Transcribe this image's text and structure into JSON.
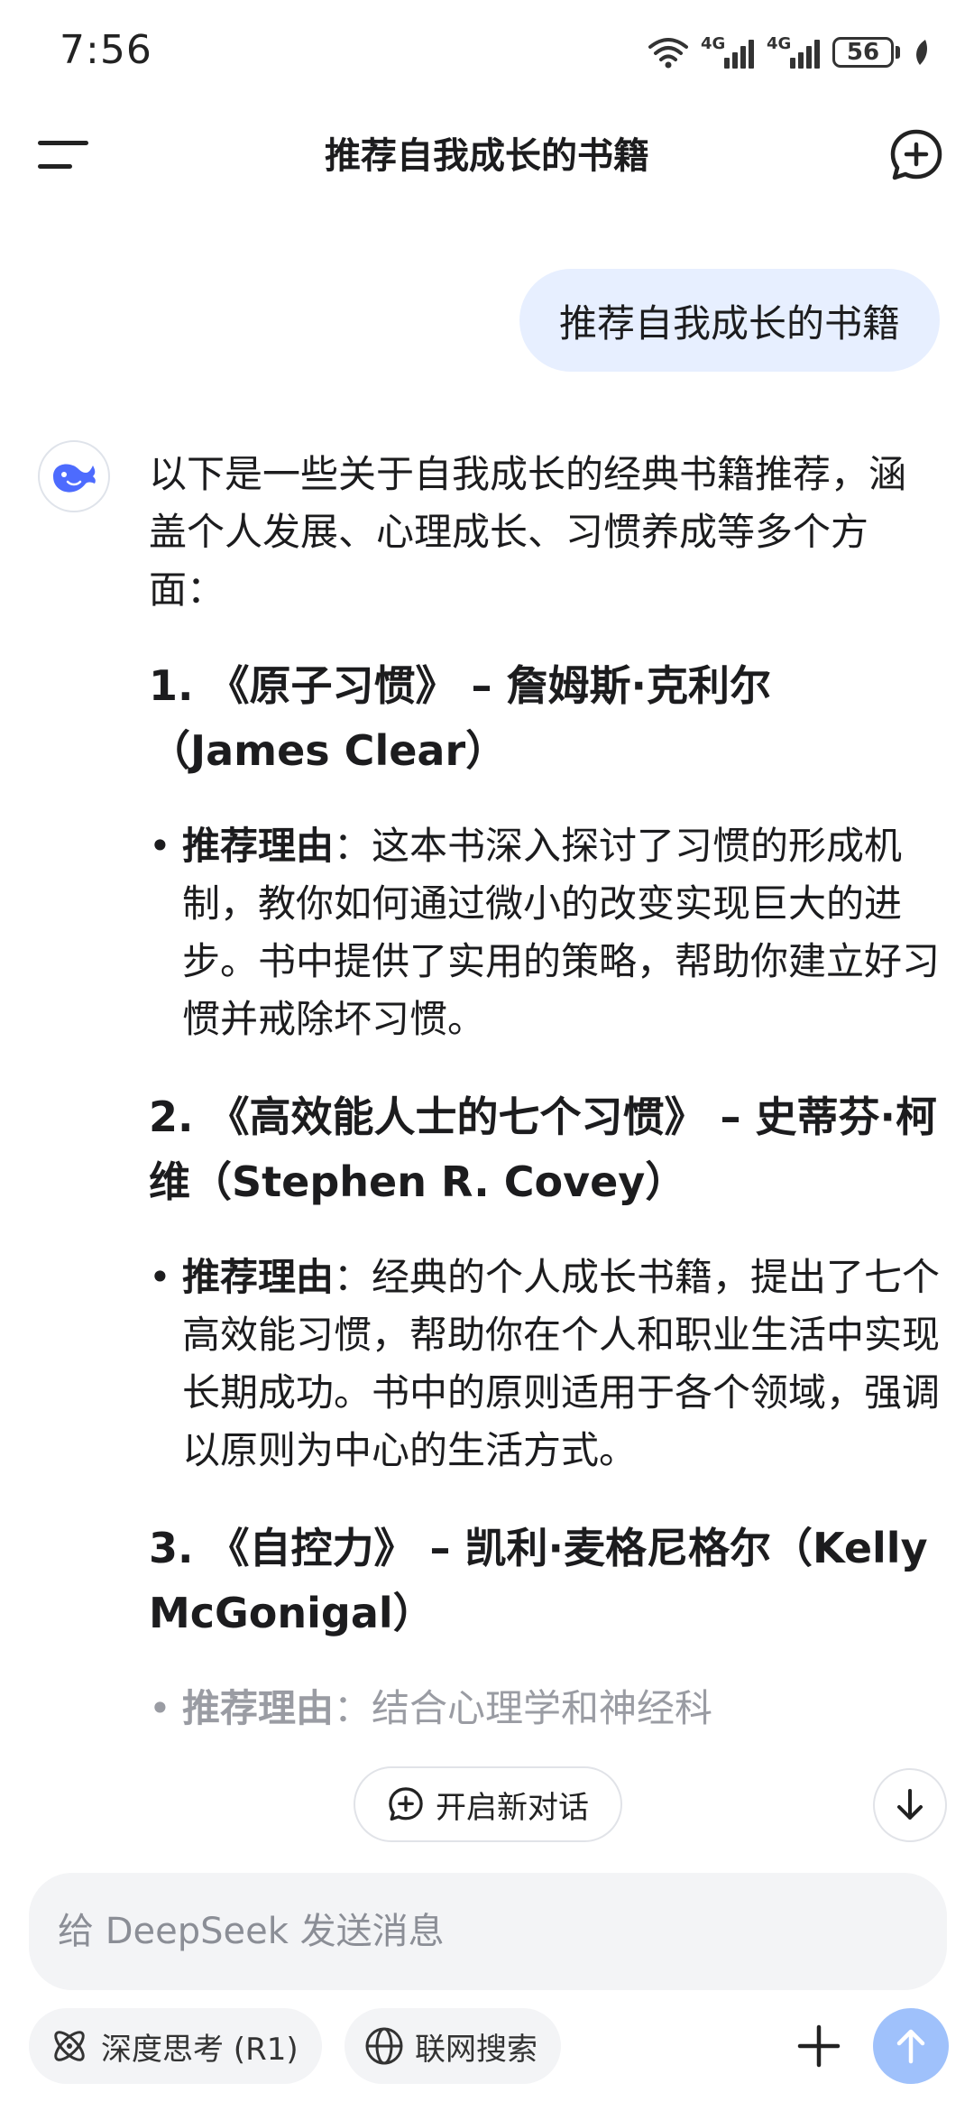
{
  "status_bar": {
    "time": "7:56",
    "network_1": "4G",
    "network_2": "4G",
    "battery": "56"
  },
  "header": {
    "title": "推荐自我成长的书籍"
  },
  "conversation": {
    "user_message": "推荐自我成长的书籍",
    "assistant": {
      "intro": "以下是一些关于自我成长的经典书籍推荐，涵盖个人发展、心理成长、习惯养成等多个方面：",
      "books": [
        {
          "heading": "1. 《原子习惯》 – 詹姆斯·克利尔（James Clear）",
          "reason_label": "推荐理由",
          "reason_text": "：这本书深入探讨了习惯的形成机制，教你如何通过微小的改变实现巨大的进步。书中提供了实用的策略，帮助你建立好习惯并戒除坏习惯。"
        },
        {
          "heading": "2. 《高效能人士的七个习惯》 – 史蒂芬·柯维（Stephen R. Covey）",
          "reason_label": "推荐理由",
          "reason_text": "：经典的个人成长书籍，提出了七个高效能习惯，帮助你在个人和职业生活中实现长期成功。书中的原则适用于各个领域，强调以原则为中心的生活方式。"
        },
        {
          "heading": "3. 《自控力》 – 凯利·麦格尼格尔（Kelly McGonigal）",
          "reason_label": "推荐理由",
          "reason_text": "：结合心理学和神经科"
        }
      ]
    }
  },
  "floating": {
    "new_dialog_label": "开启新对话"
  },
  "composer": {
    "placeholder": "给 DeepSeek 发送消息",
    "deep_think_label": "深度思考 (R1)",
    "web_search_label": "联网搜索"
  },
  "colors": {
    "accent": "#4d6bfe",
    "user_bubble": "#e7efff",
    "send_button": "#9fc1fb"
  }
}
